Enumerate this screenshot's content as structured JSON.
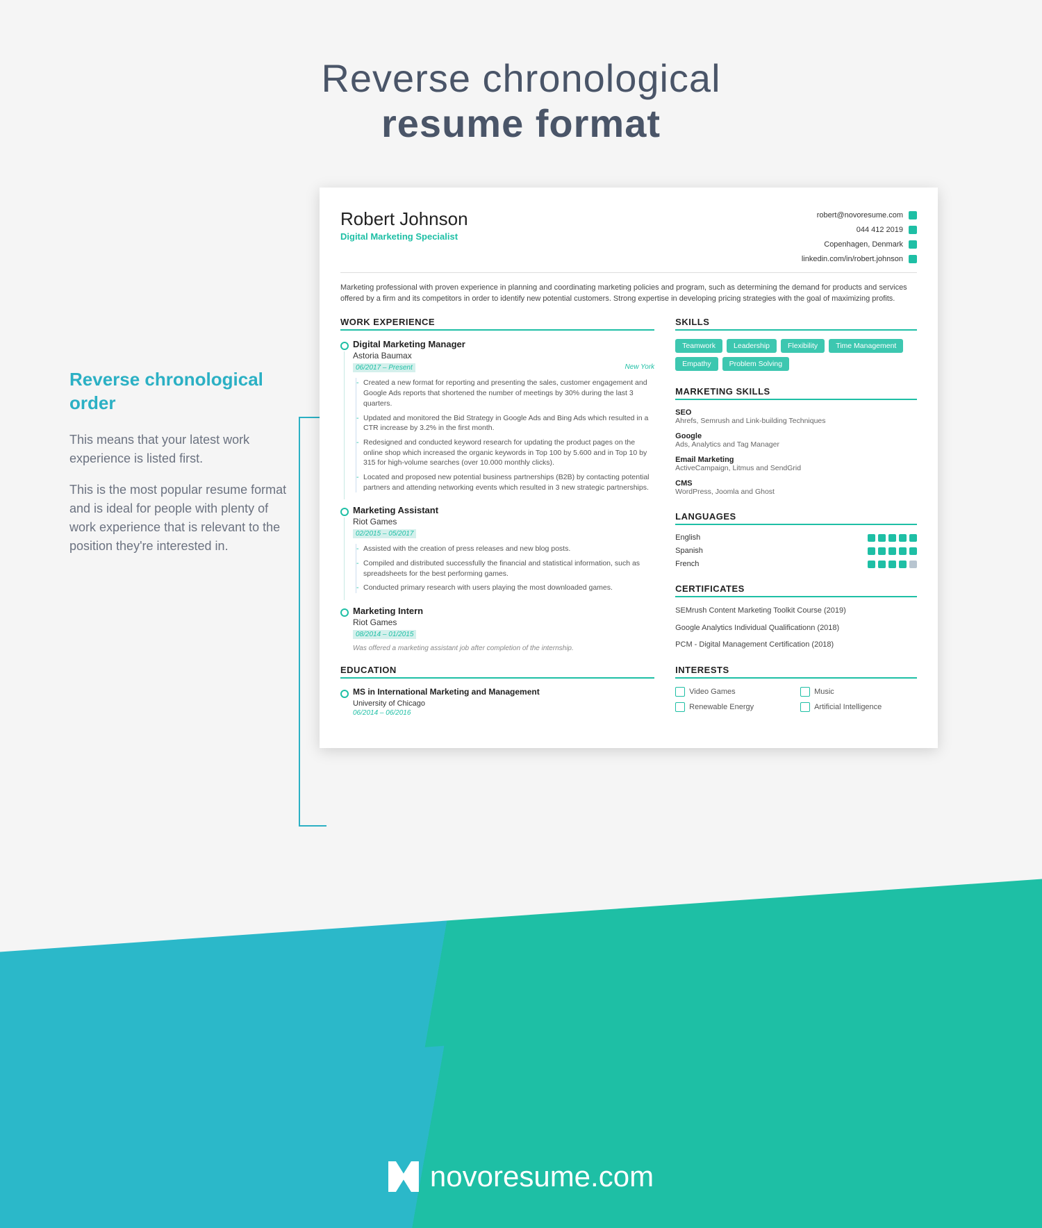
{
  "header": {
    "line1": "Reverse chronological",
    "line2": "resume format"
  },
  "annotation": {
    "title": "Reverse chronological order",
    "p1": "This means that your latest work experience is listed first.",
    "p2": "This is the most popular resume format and is ideal for people with plenty of work experience that is relevant to the position they're interested in."
  },
  "resume": {
    "name": "Robert Johnson",
    "role": "Digital Marketing Specialist",
    "contact": {
      "email": "robert@novoresume.com",
      "phone": "044 412 2019",
      "location": "Copenhagen, Denmark",
      "linkedin": "linkedin.com/in/robert.johnson"
    },
    "summary": "Marketing professional with proven experience in planning and coordinating marketing policies and program, such as determining the demand for products and services offered by a firm and its competitors in order to identify new potential customers. Strong expertise in developing pricing strategies with the goal of maximizing profits.",
    "sections": {
      "work": "WORK EXPERIENCE",
      "education": "EDUCATION",
      "skills": "SKILLS",
      "mskills": "MARKETING SKILLS",
      "languages": "LANGUAGES",
      "certs": "CERTIFICATES",
      "interests": "INTERESTS"
    },
    "jobs": [
      {
        "title": "Digital Marketing Manager",
        "company": "Astoria Baumax",
        "dates": "06/2017 – Present",
        "location": "New York",
        "bullets": [
          "Created a new format for reporting and presenting the sales, customer engagement and Google Ads reports that shortened the number of meetings by 30% during the last 3 quarters.",
          "Updated and monitored the Bid Strategy in Google Ads and Bing Ads which resulted in a CTR increase by 3.2% in the first month.",
          "Redesigned and conducted keyword research for updating the product pages on the online shop which increased the organic keywords in Top 100 by 5.600 and in Top 10 by 315 for high-volume searches (over 10.000 monthly clicks).",
          "Located and proposed new potential business partnerships (B2B) by contacting potential partners and attending networking events which resulted in 3 new strategic partnerships."
        ]
      },
      {
        "title": "Marketing Assistant",
        "company": "Riot Games",
        "dates": "02/2015 – 05/2017",
        "bullets": [
          "Assisted with the creation of press releases and new blog posts.",
          "Compiled and distributed successfully the financial and statistical information, such as spreadsheets for the best performing games.",
          "Conducted primary research with users playing the most downloaded games."
        ]
      },
      {
        "title": "Marketing Intern",
        "company": "Riot Games",
        "dates": "08/2014 – 01/2015",
        "note": "Was offered a marketing assistant job after completion of the internship."
      }
    ],
    "education": {
      "degree": "MS in International Marketing and Management",
      "school": "University of Chicago",
      "dates": "06/2014 – 06/2016"
    },
    "skills": [
      "Teamwork",
      "Leadership",
      "Flexibility",
      "Time Management",
      "Empathy",
      "Problem Solving"
    ],
    "mskills": [
      {
        "name": "SEO",
        "detail": "Ahrefs, Semrush and Link-building Techniques"
      },
      {
        "name": "Google",
        "detail": "Ads, Analytics and Tag Manager"
      },
      {
        "name": "Email Marketing",
        "detail": "ActiveCampaign, Litmus and SendGrid"
      },
      {
        "name": "CMS",
        "detail": "WordPress, Joomla and Ghost"
      }
    ],
    "languages": [
      {
        "name": "English",
        "level": 5
      },
      {
        "name": "Spanish",
        "level": 5
      },
      {
        "name": "French",
        "level": 4
      }
    ],
    "certs": [
      "SEMrush Content Marketing Toolkit Course (2019)",
      "Google Analytics Individual Qualificationn (2018)",
      "PCM - Digital Management Certification (2018)"
    ],
    "interests": [
      "Video Games",
      "Music",
      "Renewable Energy",
      "Artificial Intelligence"
    ]
  },
  "footer": {
    "brand": "novoresume.com"
  }
}
